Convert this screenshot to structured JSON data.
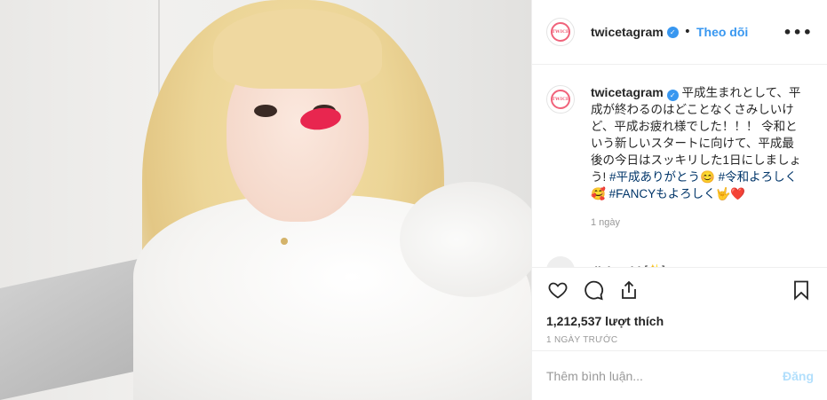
{
  "header": {
    "username": "twicetagram",
    "separator": "•",
    "follow_label": "Theo dõi",
    "more_label": "•••"
  },
  "caption": {
    "username": "twicetagram",
    "text_1": "平成生まれとして、平成が終わるのはどことなくさみしいけど、平成お疲れ様でした！！！",
    "text_2": "令和という新しいスタートに向けて、平成最後の今日はスッキリした1日にしましょう!",
    "hashtag_1": "#平成ありがとう😊",
    "hashtag_2": "#令和よろしく🥰",
    "hashtag_3": "#FANCYもよろしく🤟❤️",
    "time": "1 ngày"
  },
  "next_comment": {
    "username": "djaluvaid",
    "text": "[✨]"
  },
  "actions": {
    "likes": "1,212,537 lượt thích",
    "posted_ago": "1 NGÀY TRƯỚC"
  },
  "add_comment": {
    "placeholder": "Thêm bình luận...",
    "post_label": "Đăng"
  },
  "avatar_badge": "TWICE",
  "colors": {
    "accent": "#3897f0",
    "hashtag": "#003569",
    "muted": "#999999",
    "post_disabled": "#b2dffc"
  }
}
